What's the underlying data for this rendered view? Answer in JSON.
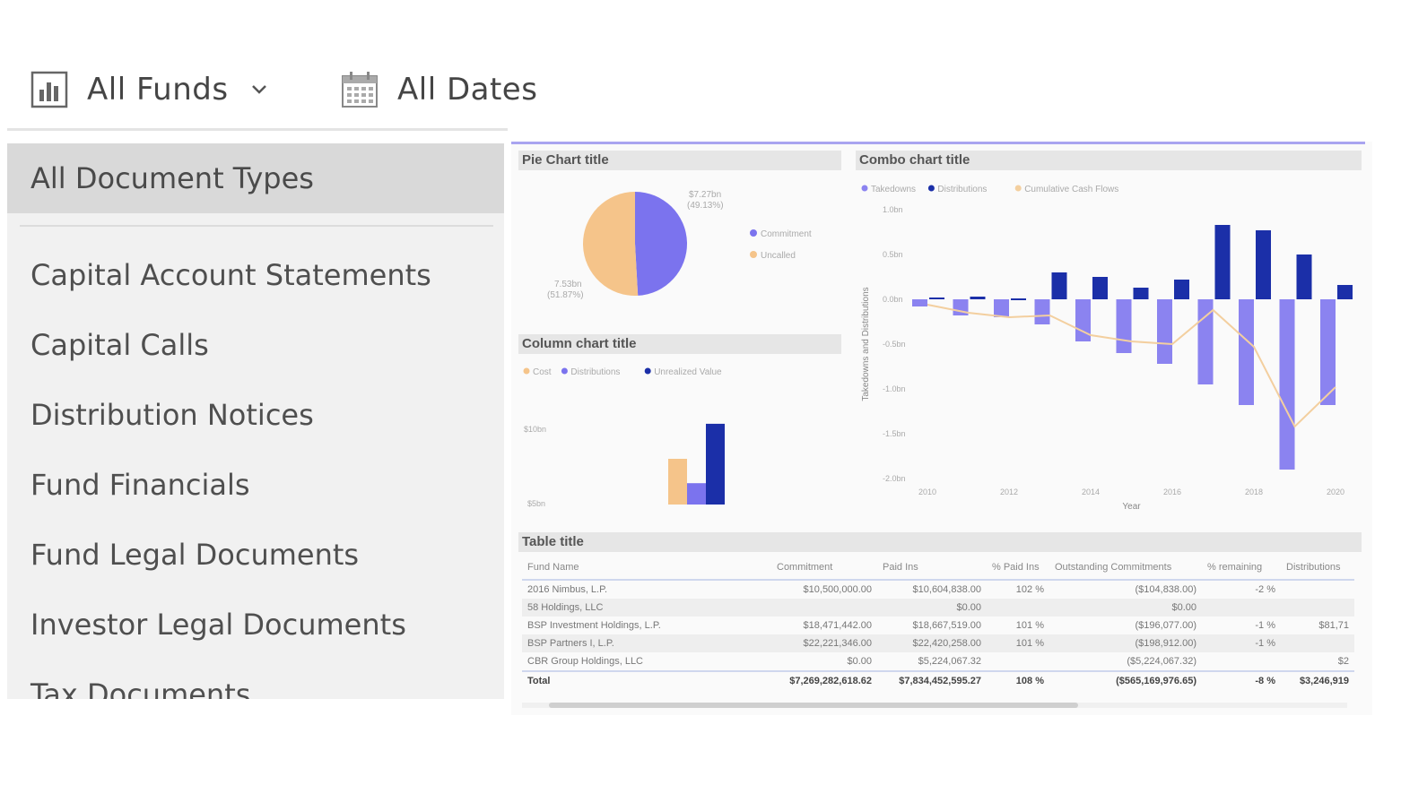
{
  "filters": {
    "funds_label": "All Funds",
    "dates_label": "All Dates"
  },
  "sidebar": {
    "selected": "All Document Types",
    "items": [
      {
        "label": "Capital Account Statements"
      },
      {
        "label": "Capital Calls"
      },
      {
        "label": "Distribution Notices"
      },
      {
        "label": "Fund Financials"
      },
      {
        "label": "Fund Legal Documents"
      },
      {
        "label": "Investor Legal Documents"
      },
      {
        "label": "Tax Documents"
      }
    ]
  },
  "colors": {
    "commitment": "#7b73ee",
    "uncalled": "#f5c48a",
    "distributions": "#1b2fa8",
    "takedowns": "#8b83f0",
    "cumulative": "#f3cf9f"
  },
  "chart_data": [
    {
      "type": "pie",
      "title": "Pie Chart title",
      "categories": [
        "Commitment",
        "Uncalled"
      ],
      "values": [
        7.27,
        7.53
      ],
      "data_labels": [
        "$7.27bn (49.13%)",
        "7.53bn (51.87%)"
      ],
      "legend": "right"
    },
    {
      "type": "bar",
      "title": "Column chart title",
      "series": [
        {
          "name": "Cost",
          "values": [
            8.0
          ]
        },
        {
          "name": "Distributions",
          "values": [
            6.4
          ]
        },
        {
          "name": "Unrealized Value",
          "values": [
            10.3
          ]
        }
      ],
      "y_ticks": [
        "$10bn",
        "$5bn"
      ],
      "ylim": [
        5,
        10
      ],
      "legend": "top"
    },
    {
      "type": "bar",
      "title": "Combo chart title",
      "xlabel": "Year",
      "ylabel": "Takedowns and Distributions",
      "x": [
        2010,
        2011,
        2012,
        2013,
        2014,
        2015,
        2016,
        2017,
        2018,
        2019,
        2020
      ],
      "x_ticks": [
        "2010",
        "2012",
        "2014",
        "2016",
        "2018",
        "2020"
      ],
      "y_ticks": [
        "1.0bn",
        "0.5bn",
        "0.0bn",
        "-0.5bn",
        "-1.0bn",
        "-1.5bn",
        "-2.0bn"
      ],
      "ylim": [
        -2.0,
        1.0
      ],
      "series": [
        {
          "name": "Takedowns",
          "values": [
            -0.08,
            -0.18,
            -0.2,
            -0.28,
            -0.47,
            -0.6,
            -0.72,
            -0.95,
            -1.18,
            -1.9,
            -1.18
          ]
        },
        {
          "name": "Distributions",
          "values": [
            0.02,
            0.03,
            0.01,
            0.3,
            0.25,
            0.13,
            0.22,
            0.83,
            0.77,
            0.5,
            0.16
          ]
        },
        {
          "name": "Cumulative Cash Flows",
          "values": [
            -0.06,
            -0.15,
            -0.2,
            -0.18,
            -0.4,
            -0.47,
            -0.5,
            -0.12,
            -0.53,
            -1.42,
            -0.98
          ]
        }
      ],
      "legend": "top-left"
    }
  ],
  "table": {
    "title": "Table title",
    "headers": [
      "Fund Name",
      "Commitment",
      "Paid Ins",
      "% Paid Ins",
      "Outstanding Commitments",
      "% remaining",
      "Distributions"
    ],
    "rows": [
      [
        "2016 Nimbus, L.P.",
        "$10,500,000.00",
        "$10,604,838.00",
        "102 %",
        "($104,838.00)",
        "-2 %",
        ""
      ],
      [
        "58 Holdings, LLC",
        "",
        "$0.00",
        "",
        "$0.00",
        "",
        ""
      ],
      [
        "BSP Investment Holdings, L.P.",
        "$18,471,442.00",
        "$18,667,519.00",
        "101 %",
        "($196,077.00)",
        "-1 %",
        "$81,71"
      ],
      [
        "BSP Partners I, L.P.",
        "$22,221,346.00",
        "$22,420,258.00",
        "101 %",
        "($198,912.00)",
        "-1 %",
        ""
      ],
      [
        "CBR Group Holdings, LLC",
        "$0.00",
        "$5,224,067.32",
        "",
        "($5,224,067.32)",
        "",
        "$2"
      ]
    ],
    "total": [
      "Total",
      "$7,269,282,618.62",
      "$7,834,452,595.27",
      "108 %",
      "($565,169,976.65)",
      "-8 %",
      "$3,246,919"
    ]
  }
}
